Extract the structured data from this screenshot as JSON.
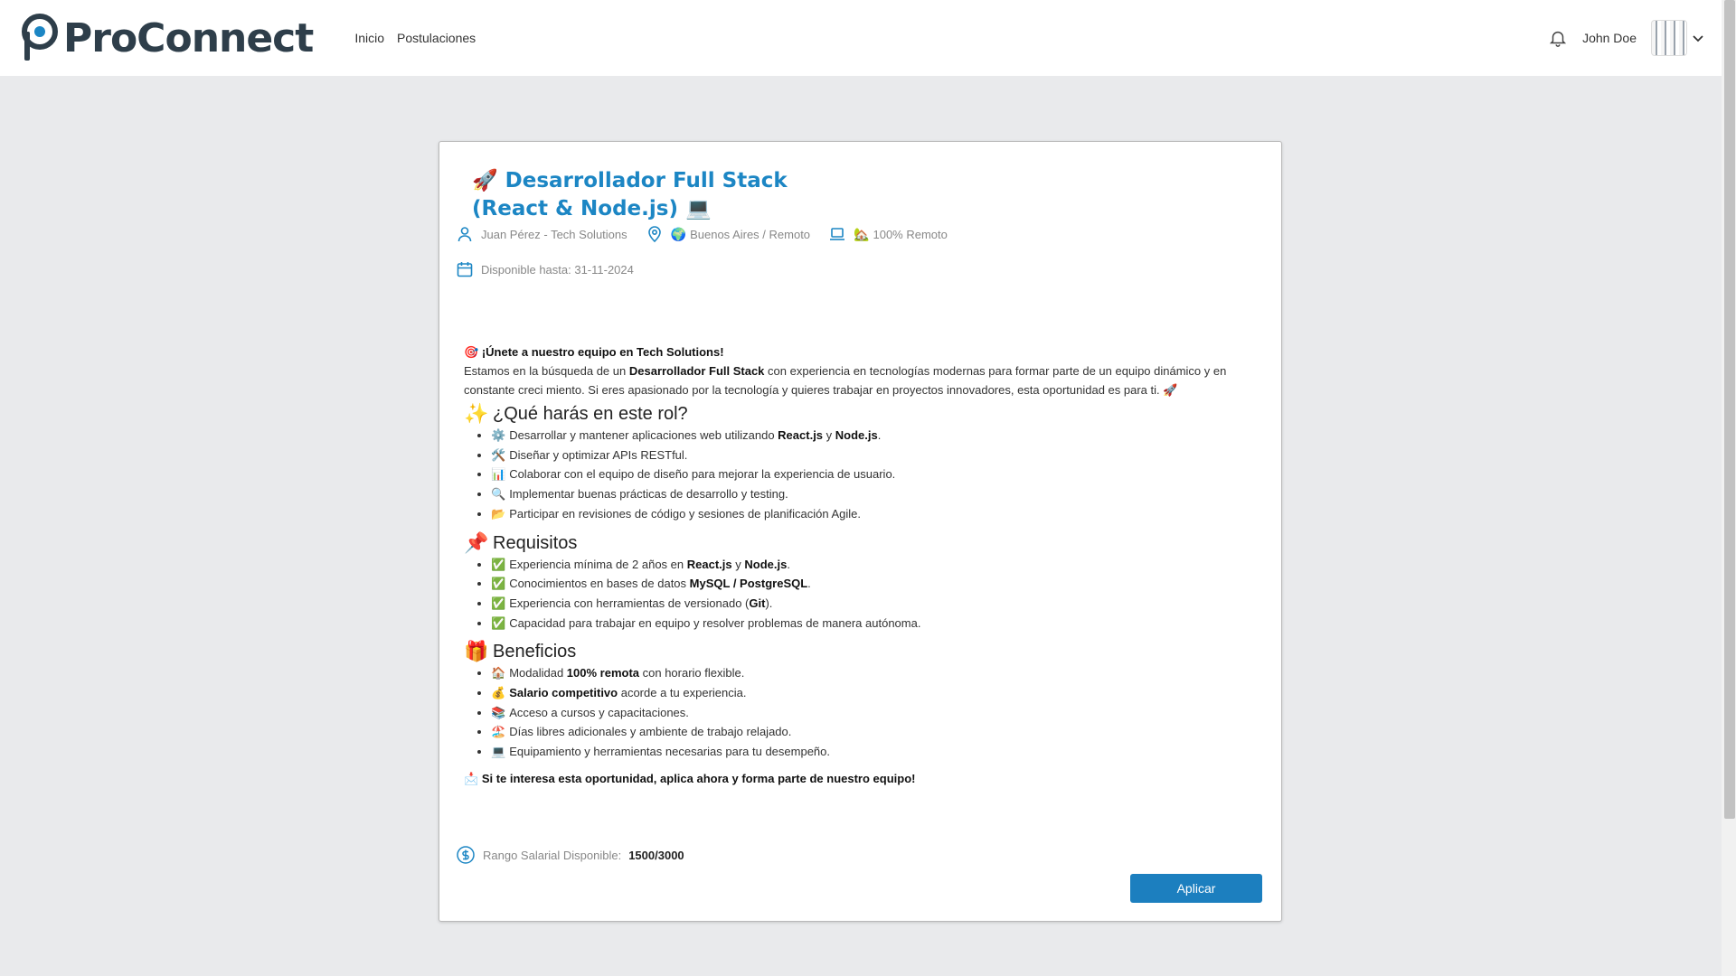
{
  "header": {
    "logo_text": "ProConnect",
    "nav": [
      {
        "label": "Inicio"
      },
      {
        "label": "Postulaciones"
      }
    ],
    "user_name": "John Doe",
    "progress": 0.2
  },
  "job": {
    "title_emoji_start": "🚀",
    "title": "Desarrollador Full Stack (React & Node.js)",
    "title_emoji_end": "💻",
    "recruiter": "Juan Pérez - Tech Solutions",
    "location_emoji": "🌍",
    "location": "Buenos Aires / Remoto",
    "modality_emoji": "🏡",
    "modality": "100% Remoto",
    "available_until": "Disponible hasta: 31-11-2024",
    "intro_emoji": "🎯",
    "intro_heading": "¡Únete a nuestro equipo en Tech Solutions!",
    "intro_text_1": "Estamos en la búsqueda de un ",
    "intro_bold": "Desarrollador Full Stack",
    "intro_text_2": " con experiencia en tecnologías modernas para formar parte de un equipo dinámico y en constante creci miento. Si eres apasionado por la tecnología y quieres trabajar en proyectos innovadores, esta oportunidad es para ti.",
    "intro_emoji_end": "🚀",
    "sections": {
      "role": {
        "emoji": "✨",
        "title": "¿Qué harás en este rol?",
        "items": [
          {
            "emoji": "⚙️",
            "text_1": "Desarrollar y mantener aplicaciones web utilizando ",
            "bold_1": "React.js",
            "text_2": " y ",
            "bold_2": "Node.js",
            "text_3": "."
          },
          {
            "emoji": "🛠️",
            "text_1": "Diseñar y optimizar APIs RESTful."
          },
          {
            "emoji": "📊",
            "text_1": "Colaborar con el equipo de diseño para mejorar la experiencia de usuario."
          },
          {
            "emoji": "🔍",
            "text_1": "Implementar buenas prácticas de desarrollo y testing."
          },
          {
            "emoji": "📂",
            "text_1": "Participar en revisiones de código y sesiones de planificación Agile."
          }
        ]
      },
      "requirements": {
        "emoji": "📌",
        "title": "Requisitos",
        "items": [
          {
            "emoji": "✅",
            "text_1": "Experiencia mínima de 2 años en ",
            "bold_1": "React.js",
            "text_2": " y ",
            "bold_2": "Node.js",
            "text_3": "."
          },
          {
            "emoji": "✅",
            "text_1": "Conocimientos en bases de datos ",
            "bold_1": "MySQL / PostgreSQL",
            "text_2": "."
          },
          {
            "emoji": "✅",
            "text_1": "Experiencia con herramientas de versionado (",
            "bold_1": "Git",
            "text_2": ")."
          },
          {
            "emoji": "✅",
            "text_1": "Capacidad para trabajar en equipo y resolver problemas de manera autónoma."
          }
        ]
      },
      "benefits": {
        "emoji": "🎁",
        "title": "Beneficios",
        "items": [
          {
            "emoji": "🏠",
            "text_1": "Modalidad ",
            "bold_1": "100% remota",
            "text_2": " con horario flexible."
          },
          {
            "emoji": "💰",
            "bold_1": "Salario competitivo",
            "text_2": " acorde a tu experiencia."
          },
          {
            "emoji": "📚",
            "text_1": "Acceso a cursos y capacitaciones."
          },
          {
            "emoji": "🏖️",
            "text_1": "Días libres adicionales y ambiente de trabajo relajado."
          },
          {
            "emoji": "💻",
            "text_1": "Equipamiento y herramientas necesarias para tu desempeño."
          }
        ]
      }
    },
    "closing_emoji": "📩",
    "closing": "Si te interesa esta oportunidad, aplica ahora y forma parte de nuestro equipo!",
    "salary_label": "Rango Salarial Disponible:",
    "salary_value": "1500/3000",
    "apply_label": "Aplicar"
  },
  "colors": {
    "accent": "#1c86c4",
    "button": "#1c7fbf",
    "background": "#e9eaec",
    "logo": "#2e3e4a"
  },
  "icons": [
    "logo-pin-icon",
    "bell-icon",
    "chevron-down-icon",
    "user-icon",
    "location-pin-icon",
    "laptop-icon",
    "calendar-icon",
    "dollar-circle-icon"
  ]
}
